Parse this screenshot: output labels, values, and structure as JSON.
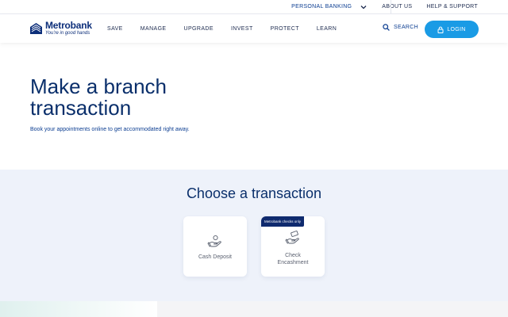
{
  "topbar": {
    "personal_banking": "PERSONAL BANKING",
    "about_us": "ABOUT US",
    "help_support": "HELP & SUPPORT"
  },
  "brand": {
    "name": "Metrobank",
    "tagline": "You're in good hands",
    "color": "#0d2f7a"
  },
  "nav": {
    "items": [
      {
        "label": "SAVE"
      },
      {
        "label": "MANAGE"
      },
      {
        "label": "UPGRADE"
      },
      {
        "label": "INVEST"
      },
      {
        "label": "PROTECT"
      },
      {
        "label": "LEARN"
      }
    ],
    "search_label": "SEARCH",
    "login_label": "LOGIN",
    "login_color": "#1a9be5"
  },
  "hero": {
    "title": "Make a branch transaction",
    "subtitle": "Book your appointments online to get accommodated right away."
  },
  "transactions": {
    "heading": "Choose a transaction",
    "cards": [
      {
        "label": "Cash Deposit",
        "icon": "hand-coin-icon"
      },
      {
        "label": "Check Encashment",
        "icon": "hand-check-icon",
        "badge": "Metrobank checks only"
      }
    ]
  }
}
